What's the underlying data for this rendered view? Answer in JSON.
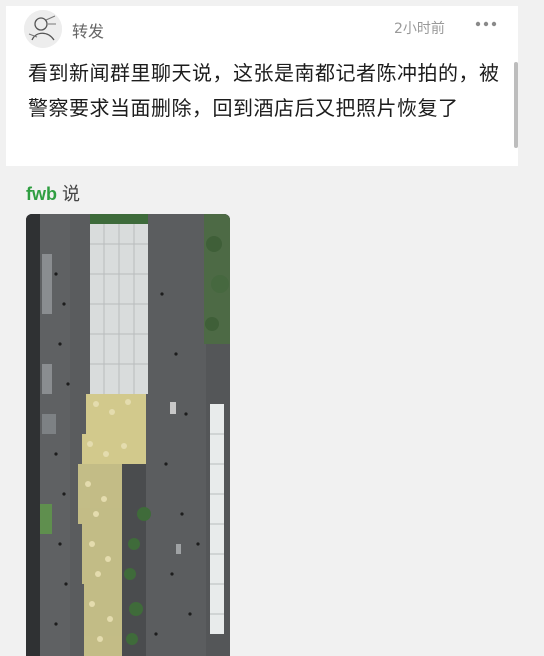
{
  "post": {
    "title": "转发",
    "time": "2小时前",
    "message": "看到新闻群里聊天说，这张是南都记者陈冲拍的，被警察要求当面删除，回到酒店后又把照片恢复了"
  },
  "reply": {
    "author": "fwb",
    "verb": "说"
  },
  "icons": {
    "avatar": "avatar-sketch-icon",
    "more": "more-dots-icon"
  },
  "colors": {
    "author": "#2f9e41",
    "background": "#f1f1f1",
    "card": "#ffffff"
  }
}
